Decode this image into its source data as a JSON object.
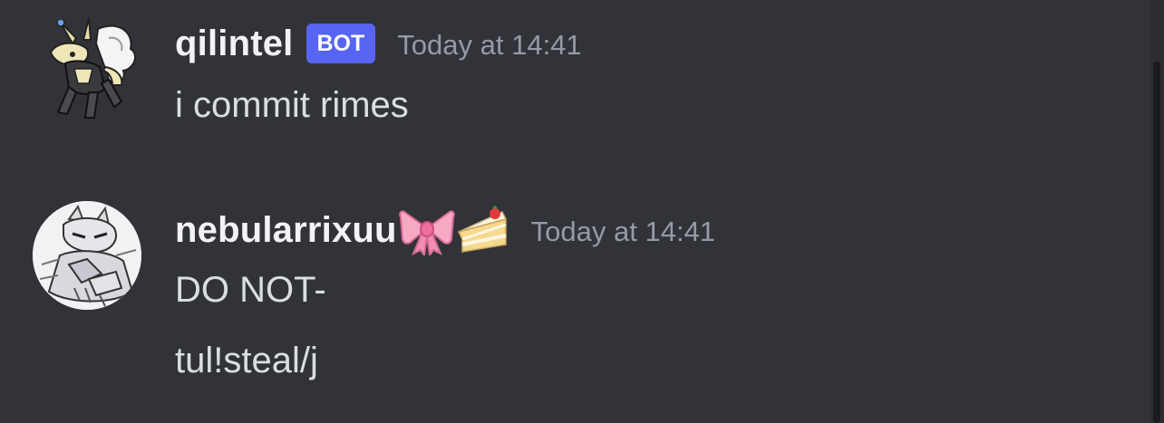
{
  "messages": [
    {
      "username": "qilintel",
      "badge": "BOT",
      "timestamp": "Today at 14:41",
      "lines": [
        "i commit rimes"
      ]
    },
    {
      "username": "nebularrixuu",
      "username_emojis": [
        "ribbon-emoji",
        "cake-slice-emoji"
      ],
      "timestamp": "Today at 14:41",
      "lines": [
        "DO NOT-",
        "tul!steal/j"
      ]
    }
  ],
  "colors": {
    "background": "#313338",
    "username": "#f2f3f5",
    "text": "#dbdee1",
    "timestamp": "#949ba4",
    "bot_badge": "#5865f2"
  }
}
